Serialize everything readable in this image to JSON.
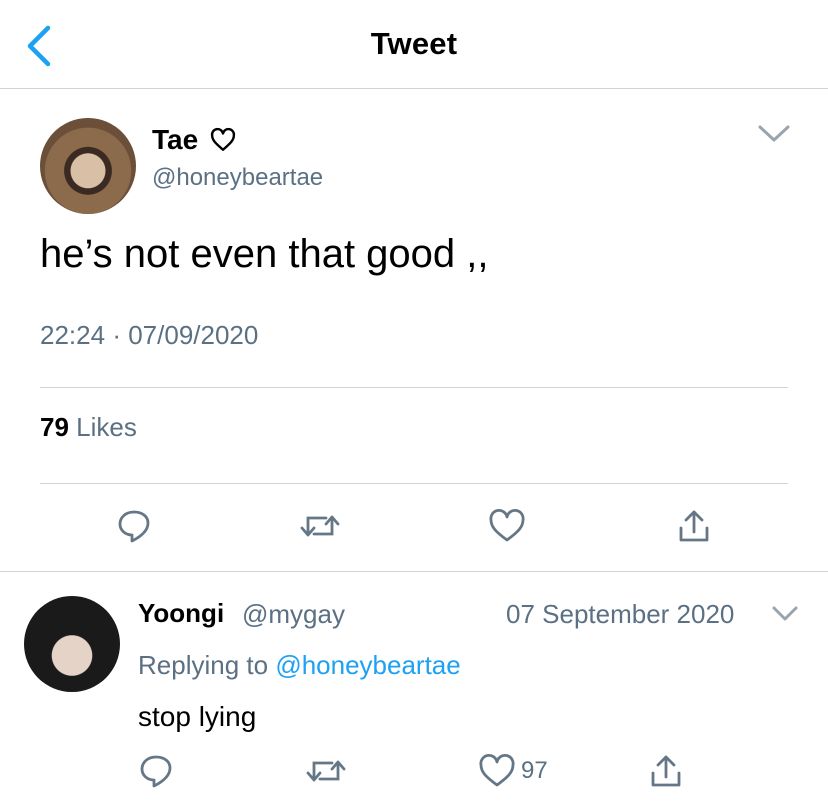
{
  "header": {
    "title": "Tweet",
    "back_icon": "chevron-left-icon"
  },
  "main_tweet": {
    "name": "Tae",
    "name_emoji_icon": "heart-outline-icon",
    "handle": "@honeybeartae",
    "text": "he’s not even that good ,,",
    "time": "22:24",
    "separator": "·",
    "date": "07/09/2020",
    "likes_count": "79",
    "likes_label": "Likes",
    "actions": [
      "reply-icon",
      "retweet-icon",
      "like-icon",
      "share-icon"
    ]
  },
  "reply": {
    "name": "Yoongi",
    "handle": "@mygay",
    "date": "07 September 2020",
    "replying_label": "Replying to",
    "replying_handle": "@honeybeartae",
    "text": "stop lying",
    "like_count": "97",
    "actions": [
      "reply-icon",
      "retweet-icon",
      "like-icon",
      "share-icon"
    ]
  },
  "colors": {
    "accent": "#1da1f2",
    "secondary_text": "#5b7083",
    "divider": "#cfd3d6"
  }
}
